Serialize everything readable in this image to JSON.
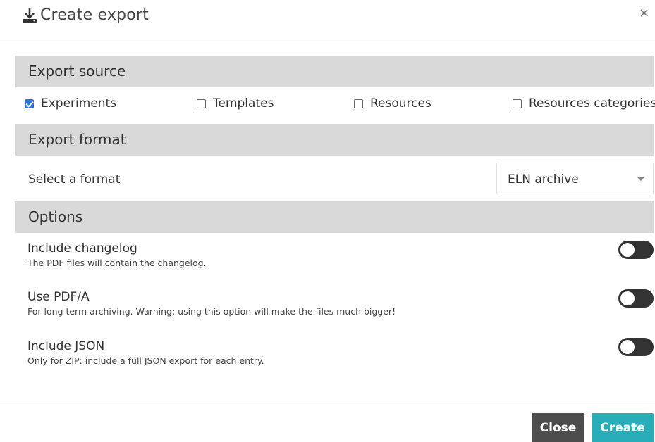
{
  "modal": {
    "title": "Create export",
    "close_glyph": "×",
    "icon": "download-icon"
  },
  "sections": {
    "source": "Export source",
    "format": "Export format",
    "options": "Options"
  },
  "source_items": [
    {
      "label": "Experiments",
      "checked": true
    },
    {
      "label": "Templates",
      "checked": false
    },
    {
      "label": "Resources",
      "checked": false
    },
    {
      "label": "Resources categories",
      "checked": false
    }
  ],
  "format": {
    "label": "Select a format",
    "selected": "ELN archive"
  },
  "options": [
    {
      "title": "Include changelog",
      "desc": "The PDF files will contain the changelog.",
      "enabled": false
    },
    {
      "title": "Use PDF/A",
      "desc": "For long term archiving. Warning: using this option will make the files much bigger!",
      "enabled": false
    },
    {
      "title": "Include JSON",
      "desc": "Only for ZIP: include a full JSON export for each entry.",
      "enabled": false
    }
  ],
  "buttons": {
    "close": "Close",
    "create": "Create"
  },
  "colors": {
    "section_bg": "#d9d9d9",
    "checkbox_accent": "#2d72d9",
    "toggle_off": "#333333",
    "close_btn": "#4d4d4d",
    "create_btn": "#29aeb9"
  }
}
